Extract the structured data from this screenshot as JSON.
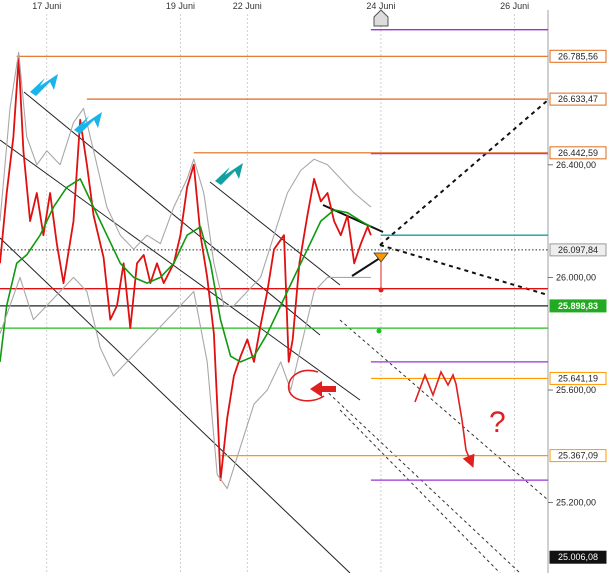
{
  "chart_data": {
    "type": "line",
    "title": "",
    "x_labels": [
      {
        "label": "17 Juni",
        "x": 0
      },
      {
        "label": "19 Juni",
        "x": 2
      },
      {
        "label": "22 Juni",
        "x": 3
      },
      {
        "label": "24 Juni",
        "x": 5
      },
      {
        "label": "26 Juni",
        "x": 7
      }
    ],
    "x_range": [
      -0.7,
      7.5
    ],
    "ylim": [
      24950,
      26950
    ],
    "y_ticks": [
      25200,
      25600,
      26000,
      26400
    ],
    "y_tick_labels": [
      "25.200,00",
      "25.600,00",
      "26.000,00",
      "26.400,00"
    ],
    "grid": true,
    "series": [
      {
        "color": "#e01010",
        "values": [
          [
            -0.7,
            26050
          ],
          [
            -0.6,
            26300
          ],
          [
            -0.5,
            26500
          ],
          [
            -0.42,
            26780
          ],
          [
            -0.35,
            26450
          ],
          [
            -0.25,
            26200
          ],
          [
            -0.15,
            26300
          ],
          [
            -0.05,
            26150
          ],
          [
            0.05,
            26300
          ],
          [
            0.15,
            26120
          ],
          [
            0.25,
            25980
          ],
          [
            0.4,
            26200
          ],
          [
            0.5,
            26560
          ],
          [
            0.6,
            26400
          ],
          [
            0.7,
            26220
          ],
          [
            0.85,
            26070
          ],
          [
            0.95,
            25850
          ],
          [
            1.05,
            25900
          ],
          [
            1.15,
            26050
          ],
          [
            1.25,
            25820
          ],
          [
            1.35,
            26050
          ],
          [
            1.45,
            26080
          ],
          [
            1.55,
            25980
          ],
          [
            1.65,
            26050
          ],
          [
            1.75,
            25980
          ],
          [
            1.9,
            26050
          ],
          [
            2.0,
            26150
          ],
          [
            2.1,
            26320
          ],
          [
            2.2,
            26400
          ],
          [
            2.3,
            26150
          ],
          [
            2.4,
            26000
          ],
          [
            2.5,
            25800
          ],
          [
            2.55,
            25550
          ],
          [
            2.6,
            25280
          ],
          [
            2.7,
            25500
          ],
          [
            2.8,
            25650
          ],
          [
            2.9,
            25720
          ],
          [
            3.0,
            25780
          ],
          [
            3.1,
            25700
          ],
          [
            3.2,
            25830
          ],
          [
            3.3,
            25950
          ],
          [
            3.4,
            26100
          ],
          [
            3.55,
            26150
          ],
          [
            3.62,
            25700
          ],
          [
            3.68,
            25780
          ],
          [
            3.78,
            26050
          ],
          [
            3.9,
            26220
          ],
          [
            4.0,
            26350
          ],
          [
            4.1,
            26270
          ],
          [
            4.2,
            26300
          ],
          [
            4.3,
            26200
          ],
          [
            4.4,
            26150
          ],
          [
            4.5,
            26220
          ],
          [
            4.6,
            26050
          ],
          [
            4.7,
            26120
          ],
          [
            4.8,
            26180
          ],
          [
            4.85,
            26150
          ]
        ]
      },
      {
        "color": "#119911",
        "values": [
          [
            -0.7,
            25700
          ],
          [
            -0.6,
            25900
          ],
          [
            -0.45,
            26050
          ],
          [
            -0.3,
            26080
          ],
          [
            -0.1,
            26150
          ],
          [
            0.1,
            26250
          ],
          [
            0.3,
            26320
          ],
          [
            0.5,
            26350
          ],
          [
            0.7,
            26250
          ],
          [
            0.9,
            26150
          ],
          [
            1.1,
            26050
          ],
          [
            1.3,
            26000
          ],
          [
            1.5,
            25980
          ],
          [
            1.7,
            26000
          ],
          [
            1.9,
            26050
          ],
          [
            2.1,
            26150
          ],
          [
            2.3,
            26180
          ],
          [
            2.45,
            26050
          ],
          [
            2.6,
            25850
          ],
          [
            2.75,
            25720
          ],
          [
            2.9,
            25700
          ],
          [
            3.1,
            25720
          ],
          [
            3.3,
            25800
          ],
          [
            3.5,
            25900
          ],
          [
            3.7,
            26000
          ],
          [
            3.9,
            26100
          ],
          [
            4.1,
            26200
          ],
          [
            4.3,
            26240
          ],
          [
            4.5,
            26230
          ],
          [
            4.7,
            26200
          ],
          [
            4.85,
            26180
          ]
        ]
      },
      {
        "color": "#a8a8a8",
        "values": [
          [
            -0.7,
            26200
          ],
          [
            -0.55,
            26600
          ],
          [
            -0.42,
            26800
          ],
          [
            -0.3,
            26500
          ],
          [
            -0.15,
            26400
          ],
          [
            0.0,
            26450
          ],
          [
            0.2,
            26400
          ],
          [
            0.4,
            26550
          ],
          [
            0.55,
            26600
          ],
          [
            0.7,
            26450
          ],
          [
            0.9,
            26250
          ],
          [
            1.1,
            26150
          ],
          [
            1.3,
            26100
          ],
          [
            1.5,
            26150
          ],
          [
            1.7,
            26120
          ],
          [
            1.9,
            26250
          ],
          [
            2.1,
            26350
          ],
          [
            2.2,
            26420
          ],
          [
            2.35,
            26300
          ],
          [
            2.5,
            26050
          ],
          [
            2.65,
            25900
          ],
          [
            2.8,
            25900
          ],
          [
            3.0,
            25950
          ],
          [
            3.2,
            26000
          ],
          [
            3.4,
            26150
          ],
          [
            3.6,
            26300
          ],
          [
            3.8,
            26380
          ],
          [
            4.0,
            26420
          ],
          [
            4.2,
            26400
          ],
          [
            4.4,
            26350
          ],
          [
            4.6,
            26300
          ],
          [
            4.85,
            26250
          ]
        ]
      },
      {
        "color": "#a8a8a8",
        "values": [
          [
            -0.7,
            25800
          ],
          [
            -0.55,
            25900
          ],
          [
            -0.4,
            26000
          ],
          [
            -0.2,
            25850
          ],
          [
            0.0,
            25900
          ],
          [
            0.2,
            25950
          ],
          [
            0.4,
            26000
          ],
          [
            0.6,
            25950
          ],
          [
            0.8,
            25750
          ],
          [
            1.0,
            25650
          ],
          [
            1.2,
            25700
          ],
          [
            1.4,
            25750
          ],
          [
            1.6,
            25800
          ],
          [
            1.8,
            25850
          ],
          [
            2.0,
            25900
          ],
          [
            2.2,
            25950
          ],
          [
            2.4,
            25700
          ],
          [
            2.55,
            25300
          ],
          [
            2.7,
            25250
          ],
          [
            2.9,
            25400
          ],
          [
            3.1,
            25550
          ],
          [
            3.3,
            25600
          ],
          [
            3.5,
            25700
          ],
          [
            3.65,
            25600
          ],
          [
            3.8,
            25750
          ],
          [
            4.0,
            25950
          ],
          [
            4.2,
            26000
          ],
          [
            4.4,
            26000
          ],
          [
            4.6,
            26000
          ],
          [
            4.85,
            26000
          ]
        ]
      }
    ],
    "levels": [
      {
        "value": 26785.56,
        "label": "26.785,56",
        "color": "#e06a1a",
        "line": "solid",
        "x_from": -0.45,
        "box": "outline"
      },
      {
        "value": 26633.47,
        "label": "26.633,47",
        "color": "#e06a1a",
        "line": "solid",
        "x_from": 0.6,
        "box": "outline"
      },
      {
        "value": 26442.59,
        "label": "26.442,59",
        "color": "#e06a1a",
        "line": "solid",
        "x_from": 2.2,
        "box": "outline"
      },
      {
        "value": 26097.84,
        "label": "26.097,84",
        "color": "#333333",
        "line": "dotted",
        "x_from": -0.7,
        "box": "gray"
      },
      {
        "value": 25898.83,
        "label": "25.898,83",
        "color": "#222222",
        "line": "solid",
        "x_from": -0.7,
        "box": "green"
      },
      {
        "value": 25641.19,
        "label": "25.641,19",
        "color": "#ff9900",
        "line": "solid",
        "x_from": 4.85,
        "box": "outline"
      },
      {
        "value": 25367.09,
        "label": "25.367,09",
        "color": "#ff9900",
        "line": "solid",
        "x_from": 2.6,
        "box": "outline"
      },
      {
        "value": 25006.08,
        "label": "25.006,08",
        "color": "#111111",
        "line": "none",
        "x_from": 7.5,
        "box": "black"
      }
    ],
    "extra_hlines": [
      {
        "value": 26880,
        "color": "#9a33d6",
        "x_from": 4.85
      },
      {
        "value": 26440,
        "color": "#9a33d6",
        "x_from": 4.85
      },
      {
        "value": 25700,
        "color": "#9a33d6",
        "x_from": 4.85
      },
      {
        "value": 25280,
        "color": "#9a33d6",
        "x_from": 4.85
      },
      {
        "value": 26150,
        "color": "#12a0a0",
        "x_from": 5.0
      },
      {
        "value": 25960,
        "color": "#e01010",
        "x_from": -0.7
      },
      {
        "value": 25820,
        "color": "#22bb22",
        "x_from": -0.7
      }
    ]
  }
}
